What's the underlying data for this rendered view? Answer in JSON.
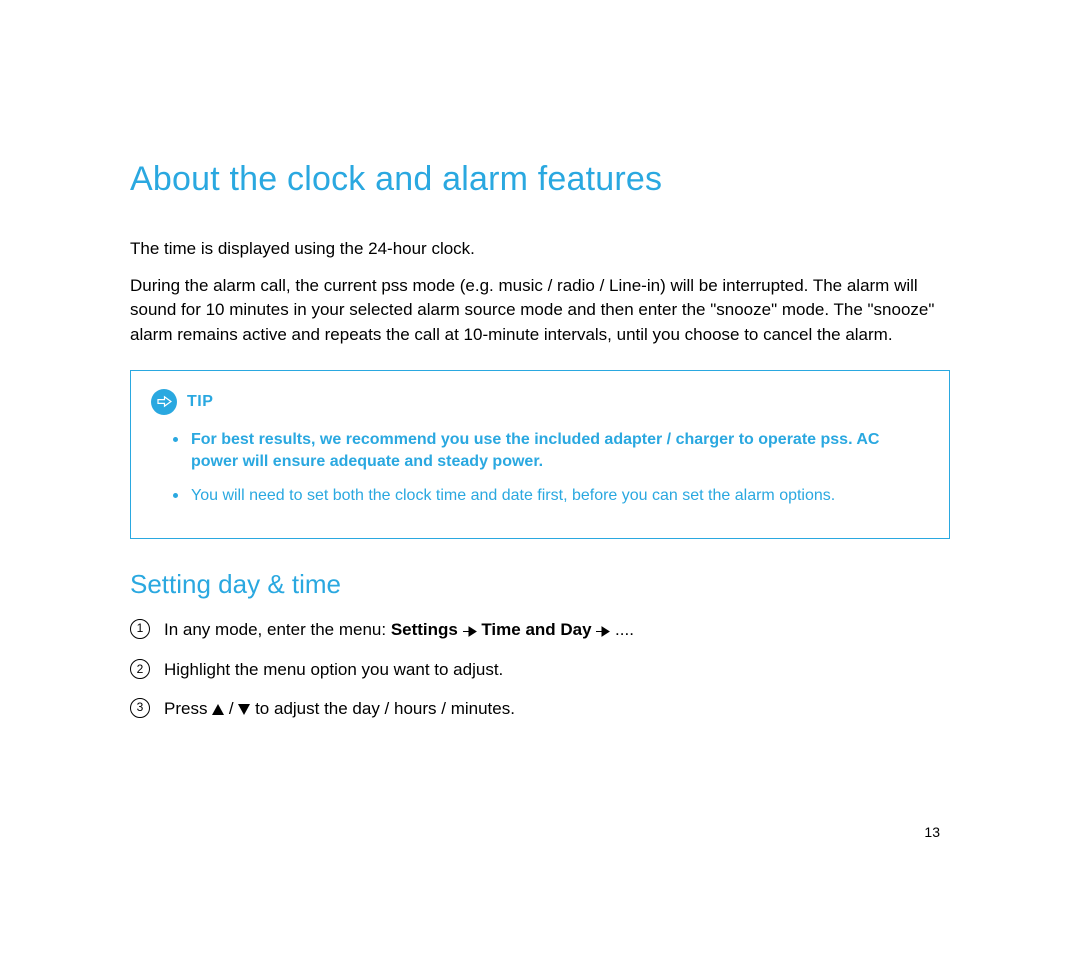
{
  "title": "About the clock and alarm features",
  "intro": {
    "p1": "The time is displayed using the 24-hour clock.",
    "p2": "During the alarm call, the current pss mode (e.g. music / radio / Line-in) will be interrupted. The alarm will sound for 10 minutes in your selected alarm source mode and then enter the \"snooze\" mode.  The \"snooze\" alarm remains active and repeats the call at 10-minute  intervals, until you choose to cancel the alarm."
  },
  "tip": {
    "label": "TIP",
    "items": [
      "For best results, we recommend you use the included adapter / charger to operate pss.  AC power will ensure adequate and steady power.",
      "You will need to set both the clock time and date first, before you can set the alarm options."
    ]
  },
  "section2": {
    "title": "Setting day & time",
    "steps": {
      "s1_pre": "In any mode, enter the menu: ",
      "s1_b1": "Settings",
      "s1_b2": "Time and Day",
      "s1_tail": " ....",
      "s2": "Highlight the menu option you want to adjust.",
      "s3_pre": "Press ",
      "s3_mid": " / ",
      "s3_post": " to adjust the day / hours / minutes.",
      "n1": "1",
      "n2": "2",
      "n3": "3"
    }
  },
  "pageNumber": "13",
  "colors": {
    "accent": "#2aa8e0"
  }
}
